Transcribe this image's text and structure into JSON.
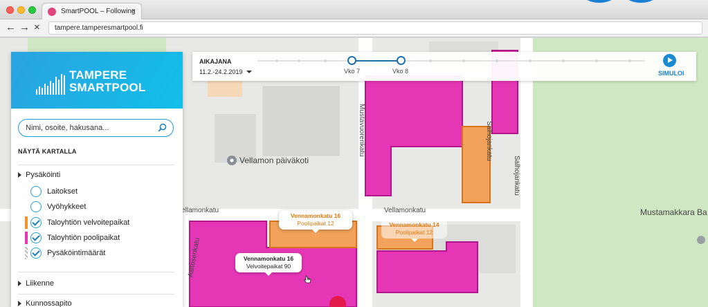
{
  "browser": {
    "tab_title": "SmartPOOL – Following",
    "tab_close": "×",
    "nav_back": "←",
    "nav_forward": "→",
    "nav_reload": "×",
    "url": "tampere.tamperesmartpool.fi"
  },
  "sidebar": {
    "logo_line1": "TAMPERE",
    "logo_line2": "SMARTPOOL",
    "search_placeholder": "Nimi, osoite, hakusana...",
    "section_title": "NÄYTÄ KARTALLA",
    "group_parking": "Pysäköinti",
    "options": [
      {
        "label": "Laitokset",
        "checked": false
      },
      {
        "label": "Vyöhykkeet",
        "checked": false
      },
      {
        "label": "Taloyhtiön velvoitepaikat",
        "checked": true,
        "color": "#f0922d"
      },
      {
        "label": "Taloyhtiön poolipaikat",
        "checked": true,
        "color": "#e536b6"
      },
      {
        "label": "Pysäköintimäärät",
        "checked": true
      }
    ],
    "group_traffic": "Liikenne",
    "group_cut": "Kunnossapito"
  },
  "timeline": {
    "title": "AIKAJANA",
    "range": "11.2.-24.2.2019",
    "week_a": "Vko 7",
    "week_b": "Vko 8",
    "simulate": "SIMULOI"
  },
  "map": {
    "street_vellamonkatu_left": "Vellamonkatu",
    "street_vellamonkatu_right": "Vellamonkatu",
    "street_salhojankatu": "Salhojankatu",
    "street_aaltosenkatu": "Aaltosenkatu",
    "street_mustavuori": "Mustavuorenkatu",
    "poi_kindergarten": "Vellamon päiväkoti",
    "poi_mustamakkara": "Mustamakkara Ba"
  },
  "callouts": {
    "a_title": "Vennamonkatu 16",
    "a_sub": "Poolipaikat 12",
    "b_title": "Vennamonkatu 14",
    "b_sub": "Poolipaikat 12",
    "c_title": "Vennamonkatu 16",
    "c_sub": "Velvoitepaikat 90"
  },
  "colors": {
    "pool": "#e536b6",
    "obligation": "#f0922d",
    "accent": "#1a8bd1",
    "park": "#cfe7c3"
  }
}
